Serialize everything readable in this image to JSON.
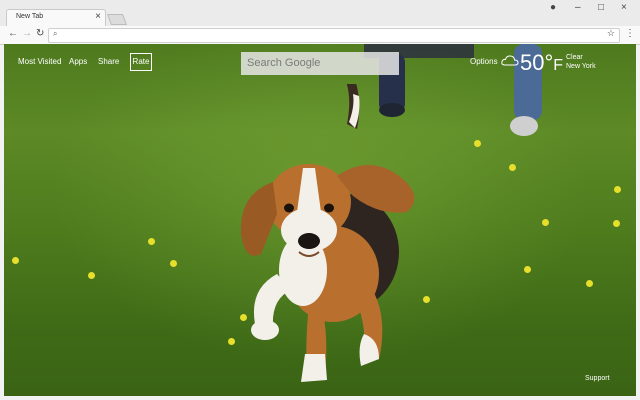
{
  "browser": {
    "tab_title": "New Tab",
    "tab_close": "×",
    "controls": {
      "profile": "●",
      "minimize": "–",
      "maximize": "□",
      "close": "×"
    },
    "nav": {
      "back": "←",
      "forward": "→",
      "reload": "↻"
    },
    "omnibox": {
      "search_icon": "⌕",
      "star_icon": "☆"
    },
    "menu": "⋮"
  },
  "page": {
    "nav_links": [
      "Most Visited",
      "Apps",
      "Share",
      "Rate"
    ],
    "search_placeholder": "Search Google",
    "options_label": "Options",
    "weather": {
      "temperature": "50°",
      "unit": "F",
      "condition": "Clear",
      "location": "New York"
    },
    "support_label": "Support"
  },
  "colors": {
    "grass": "#4e7a1e",
    "dog_tan": "#b9702e",
    "dog_white": "#f3f0ea",
    "flower": "#e7df2c"
  }
}
